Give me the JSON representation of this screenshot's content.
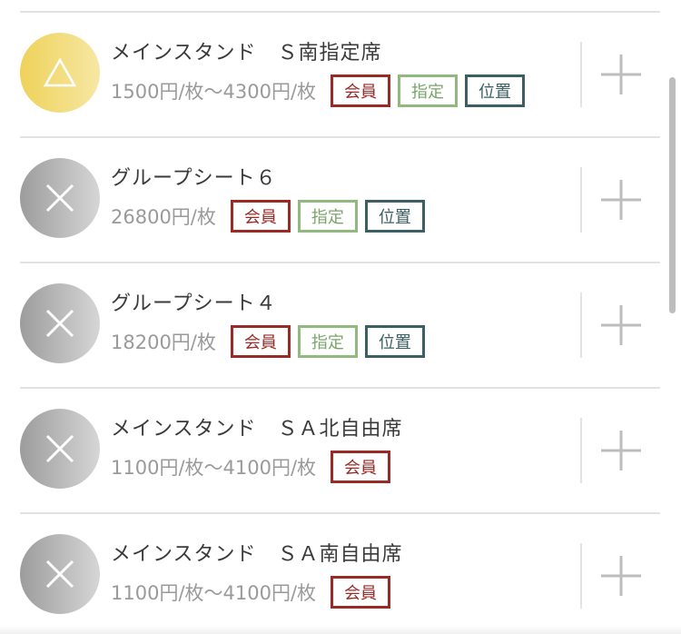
{
  "seats": [
    {
      "name": "メインスタンド　Ｓ南指定席",
      "price": "1500円/枚〜4300円/枚",
      "status_symbol": "△",
      "badges": [
        {
          "label": "会員"
        },
        {
          "label": "指定"
        },
        {
          "label": "位置"
        }
      ]
    },
    {
      "name": "グループシート６",
      "price": "26800円/枚",
      "status_symbol": "×",
      "badges": [
        {
          "label": "会員"
        },
        {
          "label": "指定"
        },
        {
          "label": "位置"
        }
      ]
    },
    {
      "name": "グループシート４",
      "price": "18200円/枚",
      "status_symbol": "×",
      "badges": [
        {
          "label": "会員"
        },
        {
          "label": "指定"
        },
        {
          "label": "位置"
        }
      ]
    },
    {
      "name": "メインスタンド　ＳＡ北自由席",
      "price": "1100円/枚〜4100円/枚",
      "status_symbol": "×",
      "badges": [
        {
          "label": "会員"
        }
      ]
    },
    {
      "name": "メインスタンド　ＳＡ南自由席",
      "price": "1100円/枚〜4100円/枚",
      "status_symbol": "×",
      "badges": [
        {
          "label": "会員"
        }
      ]
    }
  ],
  "colors": {
    "member": "#9a2a26",
    "reserved": "#8fb97f",
    "position": "#3c5f64",
    "available_few": "#efd25a",
    "sold_out": "#a8a8a8"
  },
  "icons": {
    "status_few": "triangle-icon",
    "status_none": "cross-icon",
    "add": "plus-icon"
  }
}
